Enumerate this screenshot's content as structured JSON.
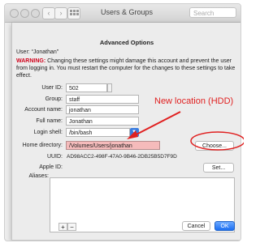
{
  "window": {
    "title": "Users & Groups",
    "search_placeholder": "Search"
  },
  "dialog": {
    "heading": "Advanced Options",
    "user_line": "User: “Jonathan”",
    "warning_label": "WARNING:",
    "warning_text": "Changing these settings might damage this account and prevent the user from logging in. You must restart the computer for the changes to these settings to take effect.",
    "fields": {
      "user_id": {
        "label": "User ID:",
        "value": "502"
      },
      "group": {
        "label": "Group:",
        "value": "staff"
      },
      "account_name": {
        "label": "Account name:",
        "value": "jonathan"
      },
      "full_name": {
        "label": "Full name:",
        "value": "Jonathan"
      },
      "login_shell": {
        "label": "Login shell:",
        "value": "/bin/bash"
      },
      "home_directory": {
        "label": "Home directory:",
        "value": "/Volumes/Users/jonathan"
      },
      "uuid": {
        "label": "UUID:",
        "value": "AD98ACC2-498F-47A0-9B46-2DB25B5D7F9D"
      },
      "apple_id": {
        "label": "Apple ID:",
        "value": ""
      },
      "aliases": {
        "label": "Aliases:"
      }
    },
    "buttons": {
      "choose": "Choose...",
      "set": "Set...",
      "add": "+",
      "remove": "−",
      "cancel": "Cancel",
      "ok": "OK"
    }
  },
  "annotation": {
    "text": "New location (HDD)",
    "color": "#e02020"
  }
}
